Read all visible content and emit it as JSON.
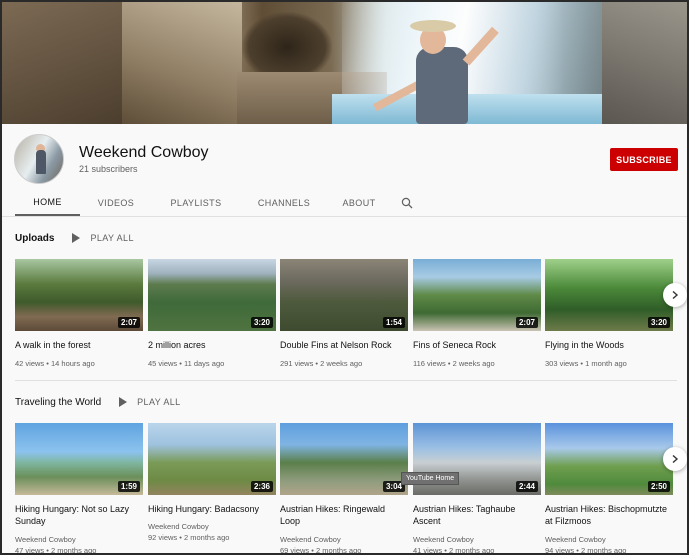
{
  "channel": {
    "name": "Weekend Cowboy",
    "subscribers": "21 subscribers",
    "subscribe_label": "SUBSCRIBE"
  },
  "tabs": {
    "home": "HOME",
    "videos": "VIDEOS",
    "playlists": "PLAYLISTS",
    "channels": "CHANNELS",
    "about": "ABOUT"
  },
  "shelves": {
    "uploads": {
      "title": "Uploads",
      "play_all": "PLAY ALL",
      "videos": [
        {
          "title": "A walk in the forest",
          "meta": "42 views • 14 hours ago",
          "duration": "2:07"
        },
        {
          "title": "2 million acres",
          "meta": "45 views • 11 days ago",
          "duration": "3:20"
        },
        {
          "title": "Double Fins at Nelson Rock",
          "meta": "291 views • 2 weeks ago",
          "duration": "1:54"
        },
        {
          "title": "Fins of Seneca Rock",
          "meta": "116 views • 2 weeks ago",
          "duration": "2:07"
        },
        {
          "title": "Flying in the Woods",
          "meta": "303 views • 1 month ago",
          "duration": "3:20"
        }
      ]
    },
    "travel": {
      "title": "Traveling the World",
      "play_all": "PLAY ALL",
      "videos": [
        {
          "title": "Hiking Hungary: Not so Lazy Sunday",
          "channel": "Weekend Cowboy",
          "meta": "47 views • 2 months ago",
          "duration": "1:59"
        },
        {
          "title": "Hiking Hungary: Badacsony",
          "channel": "Weekend Cowboy",
          "meta": "92 views • 2 months ago",
          "duration": "2:36"
        },
        {
          "title": "Austrian Hikes: Ringewald Loop",
          "channel": "Weekend Cowboy",
          "meta": "69 views • 2 months ago",
          "duration": "3:04"
        },
        {
          "title": "Austrian Hikes: Taghaube Ascent",
          "channel": "Weekend Cowboy",
          "meta": "41 views • 2 months ago",
          "duration": "2:44"
        },
        {
          "title": "Austrian Hikes: Bischopmutzte at Filzmoos",
          "channel": "Weekend Cowboy",
          "meta": "94 views • 2 months ago",
          "duration": "2:50"
        }
      ]
    }
  },
  "tooltip": "YouTube Home",
  "colors": {
    "subscribe": "#cc0000",
    "background": "#f9f9f9",
    "meta_text": "#606060"
  },
  "icons": {
    "search": "search-icon",
    "next": "chevron-right-icon",
    "play_all": "play-icon"
  }
}
